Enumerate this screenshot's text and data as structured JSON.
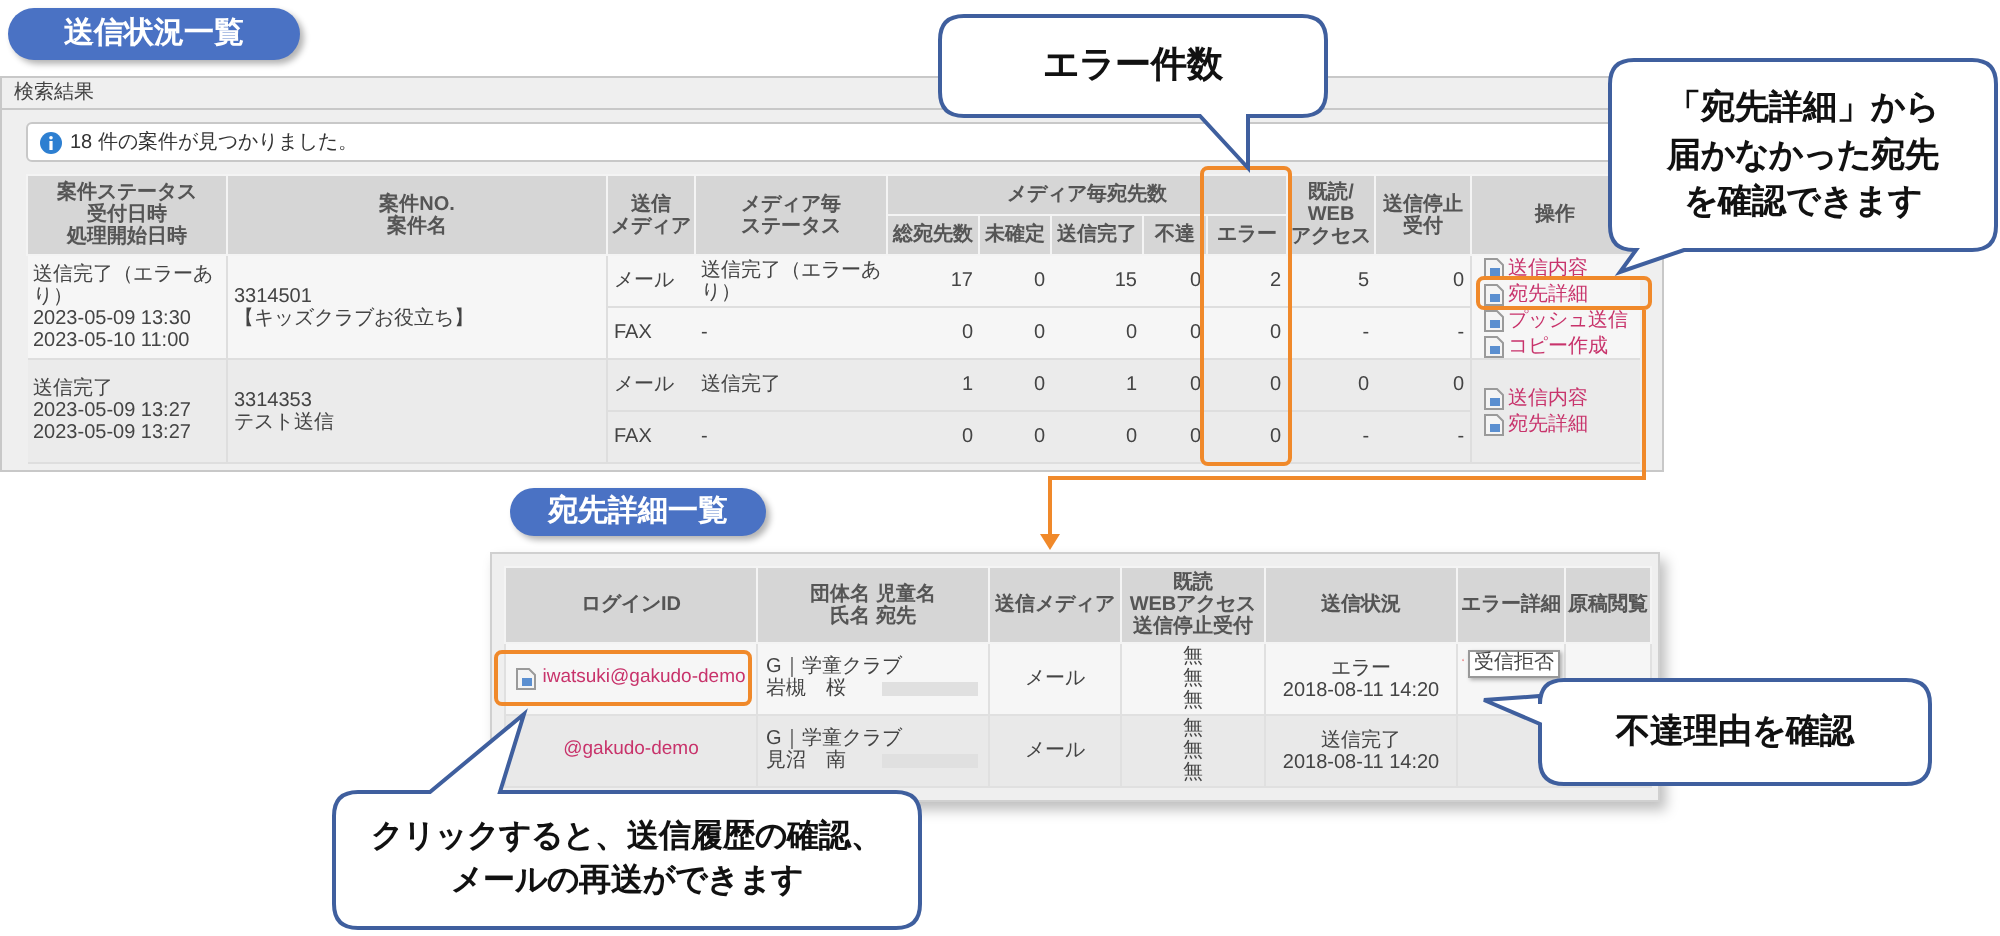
{
  "sending_status": {
    "title": "送信状況一覧",
    "panel_title": "検索結果",
    "info": "18 件の案件が見つかりました。",
    "columns": [
      [
        "案件ステータス",
        "受付日時",
        "処理開始日時"
      ],
      [
        "案件NO.",
        "案件名"
      ],
      [
        "送信",
        "メディア"
      ],
      [
        "メディア毎",
        "ステータス"
      ]
    ],
    "count_group": {
      "label": "メディア毎宛先数",
      "columns": [
        {
          "label": "総宛先数",
          "highlighted": false
        },
        {
          "label": "未確定",
          "highlighted": false
        },
        {
          "label": "送信完了",
          "highlighted": false
        },
        {
          "label": "不達",
          "highlighted": false
        },
        {
          "label": "エラー",
          "highlighted": true
        }
      ]
    },
    "columns_after": [
      [
        "既読/",
        "WEB",
        "アクセス"
      ],
      [
        "送信停止",
        "受付"
      ],
      [
        "操作"
      ]
    ],
    "cases": [
      {
        "status": "送信完了（エラーあり）",
        "received": "2023-05-09 13:30",
        "started": "2023-05-10 11:00",
        "number": "3314501",
        "name": "【キッズクラブお役立ち】",
        "media": [
          {
            "media": "メール",
            "status": "送信完了（エラーあり）",
            "counts": [
              "17",
              "0",
              "15",
              "0",
              "2"
            ],
            "read": "5",
            "stopped": "0"
          },
          {
            "media": "FAX",
            "status": "-",
            "counts": [
              "0",
              "0",
              "0",
              "0",
              "0"
            ],
            "read": "-",
            "stopped": "-"
          }
        ],
        "actions": [
          {
            "label": "送信内容",
            "highlighted": false
          },
          {
            "label": "宛先詳細",
            "highlighted": true
          },
          {
            "label": "プッシュ送信",
            "highlighted": false
          },
          {
            "label": "コピー作成",
            "highlighted": false
          }
        ]
      },
      {
        "status": "送信完了",
        "received": "2023-05-09 13:27",
        "started": "2023-05-09 13:27",
        "number": "3314353",
        "name": "テスト送信",
        "media": [
          {
            "media": "メール",
            "status": "送信完了",
            "counts": [
              "1",
              "0",
              "1",
              "0",
              "0"
            ],
            "read": "0",
            "stopped": "0"
          },
          {
            "media": "FAX",
            "status": "-",
            "counts": [
              "0",
              "0",
              "0",
              "0",
              "0"
            ],
            "read": "-",
            "stopped": "-"
          }
        ],
        "actions": [
          {
            "label": "送信内容",
            "highlighted": false
          },
          {
            "label": "宛先詳細",
            "highlighted": false
          }
        ]
      }
    ]
  },
  "recipient_details": {
    "title": "宛先詳細一覧",
    "columns": [
      [
        "ログインID"
      ],
      [
        "団体名 児童名",
        "氏名 宛先"
      ],
      [
        "送信メディア"
      ],
      [
        "既読",
        "WEBアクセス",
        "送信停止受付"
      ],
      [
        "送信状況"
      ],
      [
        "エラー詳細"
      ],
      [
        "原稿閲覧"
      ]
    ],
    "rows": [
      {
        "login_id": "iwatsuki@gakudo-demo",
        "icon": true,
        "highlighted": true,
        "group": "G｜学童クラブ",
        "name": "岩槻　桜",
        "media": "メール",
        "flags": [
          "無",
          "無",
          "無"
        ],
        "status": "エラー",
        "time": "2018-08-11 14:20",
        "error_tooltip": "受信拒否"
      },
      {
        "login_id": "@gakudo-demo",
        "icon": false,
        "highlighted": false,
        "group": "G｜学童クラブ",
        "name": "見沼　南",
        "media": "メール",
        "flags": [
          "無",
          "無",
          "無"
        ],
        "status": "送信完了",
        "time": "2018-08-11 14:20"
      }
    ]
  },
  "callouts": [
    {
      "lines": [
        "エラー件数"
      ]
    },
    {
      "lines": [
        "「宛先詳細」から",
        "届かなかった宛先",
        "を確認できます"
      ]
    },
    {
      "lines": [
        "不達理由を確認"
      ]
    },
    {
      "lines": [
        "クリックすると、送信履歴の確認、",
        "メールの再送ができます"
      ]
    }
  ]
}
